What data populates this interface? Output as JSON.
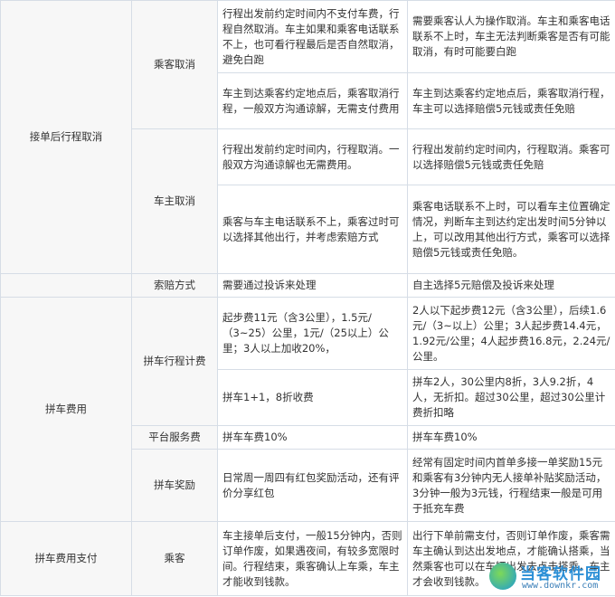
{
  "rows": {
    "r1": {
      "category": "接单后行程取消",
      "sub": "乘客取消",
      "c1": "行程出发前约定时间内不支付车费，行程自然取消。车主如果和乘客电话联系不上，也可看行程最后是否自然取消，避免白跑",
      "c2": "需要乘客认人为操作取消。车主和乘客电话联系不上时，车主无法判断乘客是否有可能取消，有时可能要白跑"
    },
    "r2": {
      "c1": "车主到达乘客约定地点后，乘客取消行程，一般双方沟通谅解，无需支付费用",
      "c2": "车主到达乘客约定地点后，乘客取消行程，车主可以选择赔偿5元钱或责任免赔"
    },
    "r3": {
      "sub": "车主取消",
      "c1": "行程出发前约定时间内，行程取消。一般双方沟通谅解也无需费用。",
      "c2": "行程出发前约定时间内，行程取消。乘客可以选择赔偿5元钱或责任免赔"
    },
    "r4": {
      "c1": "乘客与车主电话联系不上，乘客过时可以选择其他出行，并考虑索赔方式",
      "c2": "乘客电话联系不上时，可以看车主位置确定情况，判断车主到达约定出发时间5分钟以上，可以改用其他出行方式，乘客可以选择赔偿5元钱或责任免赔。"
    },
    "r5": {
      "sub": "索赔方式",
      "c1": "需要通过投诉来处理",
      "c2": "自主选择5元赔偿及投诉来处理"
    },
    "r6": {
      "category": "拼车费用",
      "sub": "拼车行程计费",
      "c1": "起步费11元（含3公里），1.5元/（3~25）公里，1元/（25以上）公里；3人以上加收20%，",
      "c2": "2人以下起步费12元（含3公里），后续1.6元/（3~以上）公里；3人起步费14.4元，1.92元/公里；4人起步费16.8元，2.24元/公里。"
    },
    "r7": {
      "c1": "拼车1+1，8折收费",
      "c2": "拼车2人，30公里内8折，3人9.2折，4人，无折扣。超过30公里，超过30公里计费折扣略"
    },
    "r8": {
      "sub": "平台服务费",
      "c1": "拼车车费10%",
      "c2": "拼车车费10%"
    },
    "r9": {
      "sub": "拼车奖励",
      "c1": "日常周一周四有红包奖励活动，还有评价分享红包",
      "c2": "经常有固定时间内首单多接一单奖励15元和乘客有3分钟内无人接单补贴奖励活动，3分钟一般为3元钱，行程结束一般是可用于抵充车费"
    },
    "r10": {
      "category": "拼车费用支付",
      "sub": "乘客",
      "c1": "车主接单后支付，一般15分钟内，否则订单作废，如果遇夜间，有较多宽限时间。行程结束，乘客确认上车乘，车主才能收到钱款。",
      "c2": "出行下单前需支付，否则订单作废，乘客需车主确认到达出发地点，才能确认搭乘，当然乘客也可以在车辆出发去点击搭乘，车主才会收到钱款。"
    }
  },
  "watermark": {
    "title": "当客软件园",
    "url": "www.downkr.com"
  }
}
